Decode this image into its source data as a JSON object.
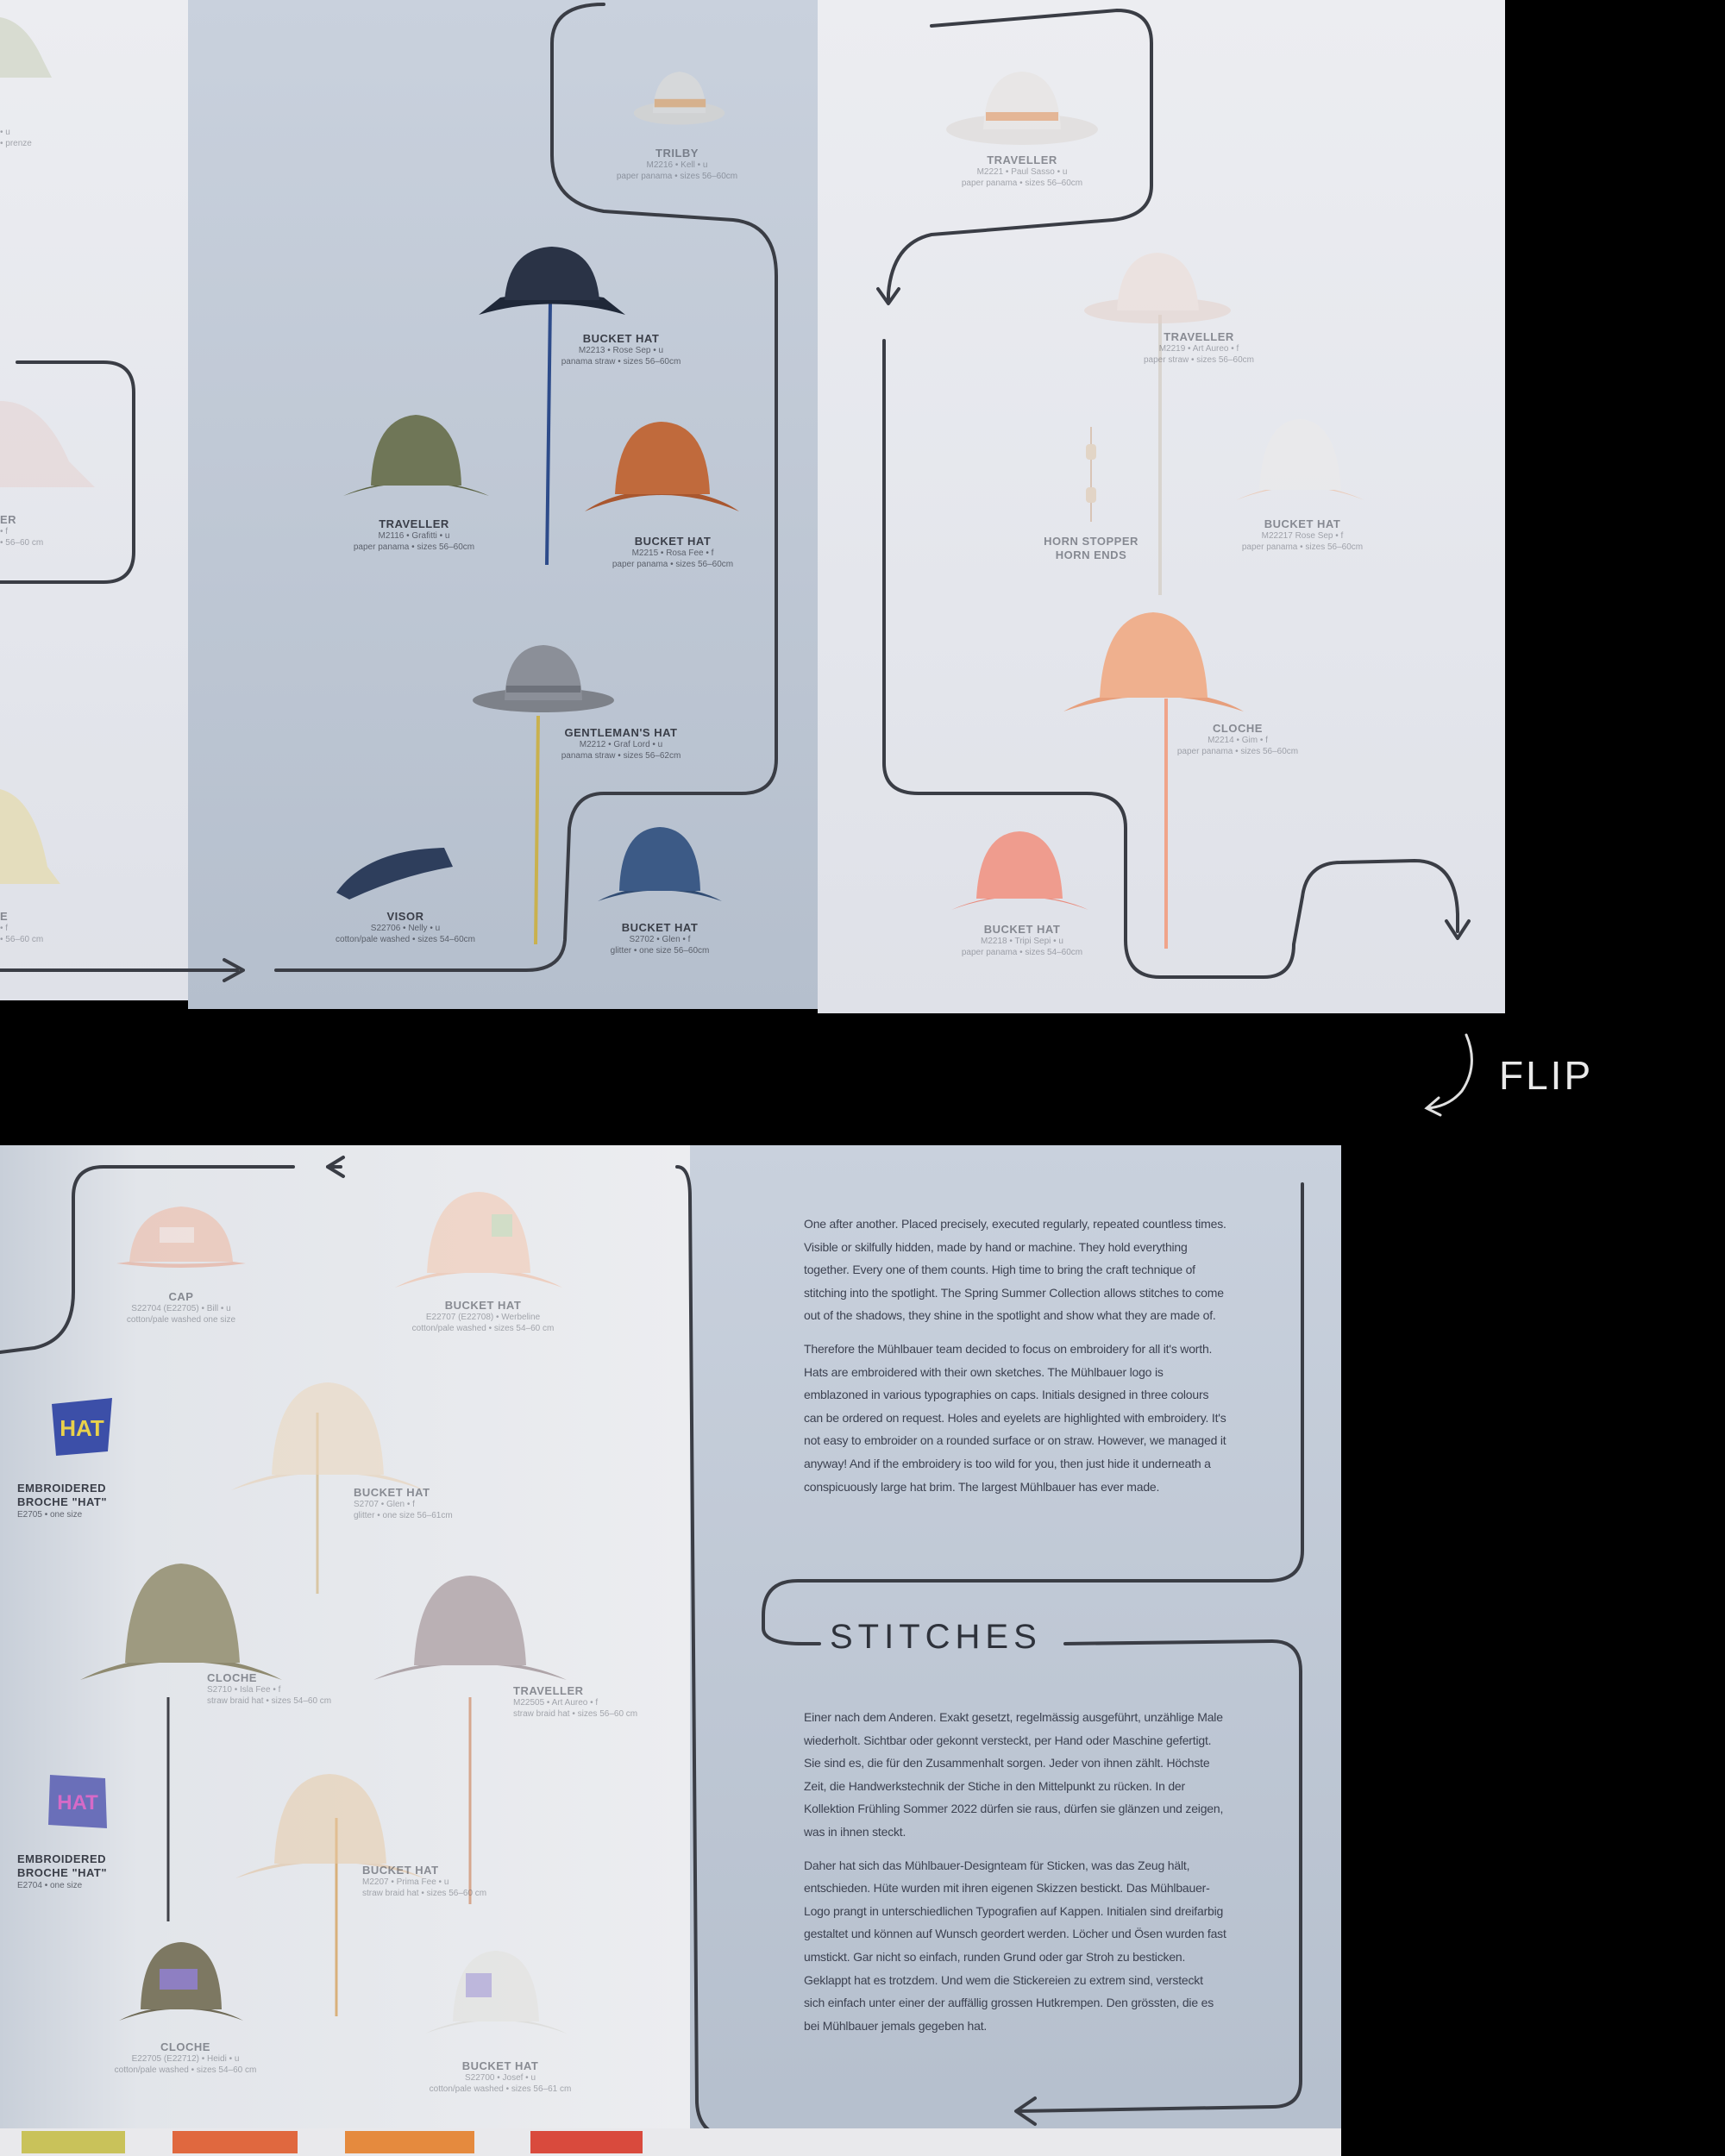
{
  "flip_label": "FLIP",
  "top_spread": {
    "products": [
      {
        "id": "trilby",
        "name": "TRILBY",
        "line1": "M2216 • Kell • u",
        "line2": "paper panama • sizes 56–60cm"
      },
      {
        "id": "traveller_a",
        "name": "TRAVELLER",
        "line1": "M2221 • Paul Sasso • u",
        "line2": "paper panama • sizes 56–60cm"
      },
      {
        "id": "bucket_a",
        "name": "BUCKET HAT",
        "line1": "M2213 • Rose Sep • u",
        "line2": "panama straw • sizes 56–60cm"
      },
      {
        "id": "traveller_b",
        "name": "TRAVELLER",
        "line1": "M2116 • Grafitti • u",
        "line2": "paper panama • sizes 56–60cm"
      },
      {
        "id": "bucket_b",
        "name": "BUCKET HAT",
        "line1": "M2215 • Rosa Fee • f",
        "line2": "paper panama • sizes 56–60cm"
      },
      {
        "id": "gentleman",
        "name": "GENTLEMAN'S HAT",
        "line1": "M2212 • Graf Lord • u",
        "line2": "panama straw • sizes 56–62cm"
      },
      {
        "id": "visor",
        "name": "VISOR",
        "line1": "S22706 • Nelly • u",
        "line2": "cotton/pale washed • sizes 54–60cm"
      },
      {
        "id": "bucket_c",
        "name": "BUCKET HAT",
        "line1": "S2702 • Glen • f",
        "line2": "glitter • one size 56–60cm"
      },
      {
        "id": "traveller_c",
        "name": "TRAVELLER",
        "line1": "M2219 • Art Aureo • f",
        "line2": "paper straw • sizes 56–60cm"
      },
      {
        "id": "horn",
        "name": "HORN STOPPER",
        "line1": "HORN ENDS",
        "line2": ""
      },
      {
        "id": "bucket_d",
        "name": "BUCKET HAT",
        "line1": "M22217 Rose Sep • f",
        "line2": "paper panama • sizes 56–60cm"
      },
      {
        "id": "cloche_a",
        "name": "CLOCHE",
        "line1": "M2214 • Gim • f",
        "line2": "paper panama • sizes 56–60cm"
      },
      {
        "id": "bucket_e",
        "name": "BUCKET HAT",
        "line1": "M2218 • Tripi Sepi • u",
        "line2": "paper panama • sizes 54–60cm"
      },
      {
        "id": "left_a",
        "name": "",
        "line1": "• u",
        "line2": "• prenze"
      },
      {
        "id": "left_b",
        "name": "ER",
        "line1": "• f",
        "line2": "• 56–60 cm"
      },
      {
        "id": "left_c",
        "name": "E",
        "line1": "• f",
        "line2": "• 56–60 cm"
      }
    ]
  },
  "bottom_spread": {
    "products": [
      {
        "id": "cap",
        "name": "CAP",
        "line1": "S22704 (E22705) • Bill • u",
        "line2": "cotton/pale washed one size"
      },
      {
        "id": "bucket_f",
        "name": "BUCKET HAT",
        "line1": "E22707 (E22708) • Werbeline",
        "line2": "cotton/pale washed • sizes 54–60 cm"
      },
      {
        "id": "brooch_a",
        "name": "EMBROIDERED BROCHE \"HAT\"",
        "line1": "E2705 • one size",
        "line2": ""
      },
      {
        "id": "bucket_g",
        "name": "BUCKET HAT",
        "line1": "S2707 • Glen • f",
        "line2": "glitter • one size 56–61cm"
      },
      {
        "id": "cloche_b",
        "name": "CLOCHE",
        "line1": "S2710 • Isla Fee • f",
        "line2": "straw braid hat • sizes 54–60 cm"
      },
      {
        "id": "traveller_d",
        "name": "TRAVELLER",
        "line1": "M22505 • Art Aureo • f",
        "line2": "straw braid hat • sizes 56–60 cm"
      },
      {
        "id": "brooch_b",
        "name": "EMBROIDERED BROCHE \"HAT\"",
        "line1": "E2704 • one size",
        "line2": ""
      },
      {
        "id": "bucket_h",
        "name": "BUCKET HAT",
        "line1": "M2207 • Prima Fee • u",
        "line2": "straw braid hat • sizes 56–60 cm"
      },
      {
        "id": "cloche_c",
        "name": "CLOCHE",
        "line1": "E22705 (E22712) • Heidi • u",
        "line2": "cotton/pale washed • sizes 54–60 cm"
      },
      {
        "id": "bucket_i",
        "name": "BUCKET HAT",
        "line1": "S22700 • Josef • u",
        "line2": "cotton/pale washed • sizes 56–61 cm"
      }
    ],
    "brooch_text": "HAT",
    "heading": "STITCHES",
    "english_paragraphs": [
      "One after another. Placed precisely, executed regularly, repeated countless times. Visible or skilfully hidden, made by hand or machine. They hold everything together. Every one of them counts. High time to bring the craft technique of stitching into the spotlight. The Spring Summer Collection allows stitches to come out of the shadows, they shine in the spotlight and show what they are made of.",
      "Therefore the Mühlbauer team decided to focus on embroidery for all it's worth. Hats are embroidered with their own sketches. The Mühlbauer logo is emblazoned in various typographies on caps. Initials designed in three colours can be ordered on request. Holes and eyelets are highlighted with embroidery. It's not easy to embroider on a rounded surface or on straw. However, we managed it anyway! And if the embroidery is too wild for you, then just hide it underneath a conspicuously large hat brim. The largest Mühlbauer has ever made."
    ],
    "german_paragraphs": [
      "Einer nach dem Anderen. Exakt gesetzt, regelmässig ausgeführt, unzählige Male wiederholt. Sichtbar oder gekonnt versteckt, per Hand oder Maschine gefertigt. Sie sind es, die für den Zusammenhalt sorgen. Jeder von ihnen zählt. Höchste Zeit, die Handwerkstechnik der Stiche in den Mittelpunkt zu rücken. In der Kollektion Frühling Sommer 2022 dürfen sie raus, dürfen sie glänzen und zeigen, was in ihnen steckt.",
      "Daher hat sich das Mühlbauer-Designteam für Sticken, was das Zeug hält, entschieden. Hüte wurden mit ihren eigenen Skizzen bestickt. Das Mühlbauer-Logo prangt in unterschiedlichen Typografien auf Kappen. Initialen sind dreifarbig gestaltet und können auf Wunsch geordert werden. Löcher und Ösen wurden fast umstickt. Gar nicht so einfach, runden Grund oder gar Stroh zu besticken. Geklappt hat es trotzdem. Und wem die Stickereien zu extrem sind, versteckt sich einfach unter einer der auffällig grossen Hutkrempen. Den grössten, die es bei Mühlbauer jemals gegeben hat."
    ],
    "swatch_colors": [
      "#c9c25a",
      "#e0683f",
      "#e58a3e",
      "#d94a3d"
    ]
  },
  "colors": {
    "background": "#000000",
    "line": "#3a3d45",
    "navy_hat": "#2a3346",
    "olive_hat": "#6f7657",
    "rust_hat": "#c06a3c",
    "grey_hat": "#8b8f98",
    "blue_hat": "#3c5a86",
    "peach_hat": "#efb08e",
    "coral_hat": "#ef9c8e"
  }
}
